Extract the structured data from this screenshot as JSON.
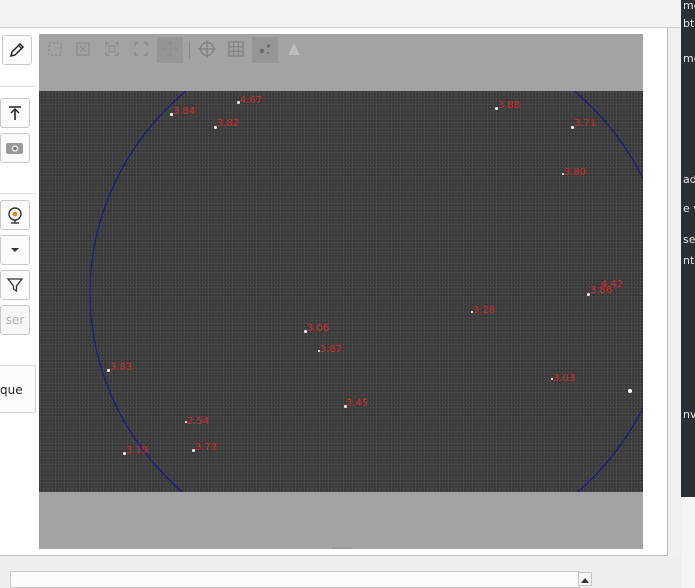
{
  "left_panel": {
    "mid_label": "ser",
    "bottom_label": "que"
  },
  "viewer": {
    "toolbar_icons": [
      "select-icon",
      "crop-icon",
      "zoom-fit-icon",
      "zoom-full-icon",
      "pan-icon",
      "crosshair-icon",
      "grid-icon",
      "stars-icon",
      "triangle-icon"
    ],
    "hfr_labels": [
      {
        "text": "3.84"
      },
      {
        "text": "4.67"
      },
      {
        "text": "3.82"
      },
      {
        "text": "3.88"
      },
      {
        "text": "3.71"
      },
      {
        "text": "3.80"
      },
      {
        "text": "4.42"
      },
      {
        "text": "3.86"
      },
      {
        "text": "3.28"
      },
      {
        "text": "3.06"
      },
      {
        "text": "3.87"
      },
      {
        "text": "3.83"
      },
      {
        "text": "3.03"
      },
      {
        "text": "3.45"
      },
      {
        "text": "2.54"
      },
      {
        "text": "3.19"
      },
      {
        "text": "3.73"
      }
    ]
  },
  "right_panel": {
    "lines": [
      "me",
      "bt",
      "me",
      "ad",
      "e v",
      "se",
      "nt",
      "nvi"
    ]
  },
  "colors": {
    "hfr_label": "#d92a2a",
    "circle": "#1a1a8c",
    "image_bg": "#3d3d3d",
    "viewer_bg": "#a3a3a3"
  }
}
